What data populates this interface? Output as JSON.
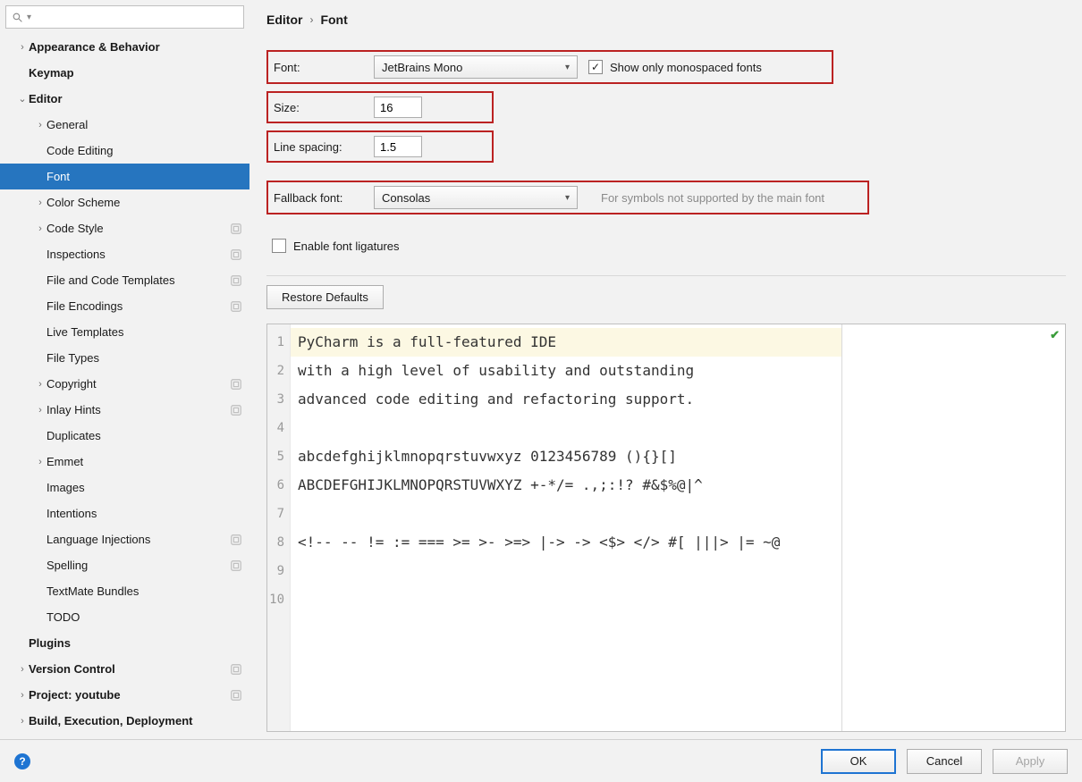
{
  "breadcrumb": {
    "parent": "Editor",
    "page": "Font"
  },
  "search": {
    "placeholder": ""
  },
  "sidebar": {
    "items": [
      {
        "label": "Appearance & Behavior",
        "level": 0,
        "arrow": ">",
        "bold": true
      },
      {
        "label": "Keymap",
        "level": 0,
        "arrow": "",
        "bold": true
      },
      {
        "label": "Editor",
        "level": 0,
        "arrow": "v",
        "bold": true
      },
      {
        "label": "General",
        "level": 1,
        "arrow": ">"
      },
      {
        "label": "Code Editing",
        "level": 1,
        "arrow": ""
      },
      {
        "label": "Font",
        "level": 1,
        "arrow": "",
        "selected": true
      },
      {
        "label": "Color Scheme",
        "level": 1,
        "arrow": ">"
      },
      {
        "label": "Code Style",
        "level": 1,
        "arrow": ">",
        "badge": true
      },
      {
        "label": "Inspections",
        "level": 1,
        "arrow": "",
        "badge": true
      },
      {
        "label": "File and Code Templates",
        "level": 1,
        "arrow": "",
        "badge": true
      },
      {
        "label": "File Encodings",
        "level": 1,
        "arrow": "",
        "badge": true
      },
      {
        "label": "Live Templates",
        "level": 1,
        "arrow": ""
      },
      {
        "label": "File Types",
        "level": 1,
        "arrow": ""
      },
      {
        "label": "Copyright",
        "level": 1,
        "arrow": ">",
        "badge": true
      },
      {
        "label": "Inlay Hints",
        "level": 1,
        "arrow": ">",
        "badge": true
      },
      {
        "label": "Duplicates",
        "level": 1,
        "arrow": ""
      },
      {
        "label": "Emmet",
        "level": 1,
        "arrow": ">"
      },
      {
        "label": "Images",
        "level": 1,
        "arrow": ""
      },
      {
        "label": "Intentions",
        "level": 1,
        "arrow": ""
      },
      {
        "label": "Language Injections",
        "level": 1,
        "arrow": "",
        "badge": true
      },
      {
        "label": "Spelling",
        "level": 1,
        "arrow": "",
        "badge": true
      },
      {
        "label": "TextMate Bundles",
        "level": 1,
        "arrow": ""
      },
      {
        "label": "TODO",
        "level": 1,
        "arrow": ""
      },
      {
        "label": "Plugins",
        "level": 0,
        "arrow": "",
        "bold": true
      },
      {
        "label": "Version Control",
        "level": 0,
        "arrow": ">",
        "bold": true,
        "badge": true
      },
      {
        "label": "Project: youtube",
        "level": 0,
        "arrow": ">",
        "bold": true,
        "badge": true
      },
      {
        "label": "Build, Execution, Deployment",
        "level": 0,
        "arrow": ">",
        "bold": true
      }
    ]
  },
  "form": {
    "font_label": "Font:",
    "font_value": "JetBrains Mono",
    "show_mono_label": "Show only monospaced fonts",
    "show_mono_checked": true,
    "size_label": "Size:",
    "size_value": "16",
    "line_spacing_label": "Line spacing:",
    "line_spacing_value": "1.5",
    "fallback_label": "Fallback font:",
    "fallback_value": "Consolas",
    "fallback_hint": "For symbols not supported by the main font",
    "ligatures_label": "Enable font ligatures",
    "ligatures_checked": false,
    "restore_label": "Restore Defaults"
  },
  "preview": {
    "lines": [
      "PyCharm is a full-featured IDE",
      "with a high level of usability and outstanding",
      "advanced code editing and refactoring support.",
      "",
      "abcdefghijklmnopqrstuvwxyz 0123456789 (){}[]",
      "ABCDEFGHIJKLMNOPQRSTUVWXYZ +-*/= .,;:!? #&$%@|^",
      "",
      "<!-- -- != := === >= >- >=> |-> -> <$> </> #[ |||> |= ~@",
      "",
      ""
    ],
    "line_numbers": [
      "1",
      "2",
      "3",
      "4",
      "5",
      "6",
      "7",
      "8",
      "9",
      "10"
    ]
  },
  "buttons": {
    "ok": "OK",
    "cancel": "Cancel",
    "apply": "Apply"
  }
}
